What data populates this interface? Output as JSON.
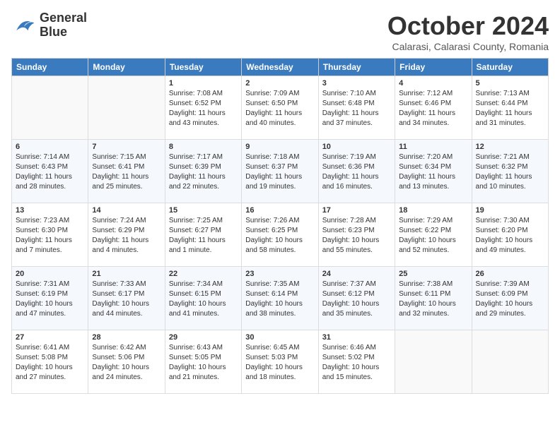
{
  "logo": {
    "line1": "General",
    "line2": "Blue"
  },
  "title": "October 2024",
  "subtitle": "Calarasi, Calarasi County, Romania",
  "headers": [
    "Sunday",
    "Monday",
    "Tuesday",
    "Wednesday",
    "Thursday",
    "Friday",
    "Saturday"
  ],
  "weeks": [
    [
      {
        "day": "",
        "details": ""
      },
      {
        "day": "",
        "details": ""
      },
      {
        "day": "1",
        "details": "Sunrise: 7:08 AM\nSunset: 6:52 PM\nDaylight: 11 hours and 43 minutes."
      },
      {
        "day": "2",
        "details": "Sunrise: 7:09 AM\nSunset: 6:50 PM\nDaylight: 11 hours and 40 minutes."
      },
      {
        "day": "3",
        "details": "Sunrise: 7:10 AM\nSunset: 6:48 PM\nDaylight: 11 hours and 37 minutes."
      },
      {
        "day": "4",
        "details": "Sunrise: 7:12 AM\nSunset: 6:46 PM\nDaylight: 11 hours and 34 minutes."
      },
      {
        "day": "5",
        "details": "Sunrise: 7:13 AM\nSunset: 6:44 PM\nDaylight: 11 hours and 31 minutes."
      }
    ],
    [
      {
        "day": "6",
        "details": "Sunrise: 7:14 AM\nSunset: 6:43 PM\nDaylight: 11 hours and 28 minutes."
      },
      {
        "day": "7",
        "details": "Sunrise: 7:15 AM\nSunset: 6:41 PM\nDaylight: 11 hours and 25 minutes."
      },
      {
        "day": "8",
        "details": "Sunrise: 7:17 AM\nSunset: 6:39 PM\nDaylight: 11 hours and 22 minutes."
      },
      {
        "day": "9",
        "details": "Sunrise: 7:18 AM\nSunset: 6:37 PM\nDaylight: 11 hours and 19 minutes."
      },
      {
        "day": "10",
        "details": "Sunrise: 7:19 AM\nSunset: 6:36 PM\nDaylight: 11 hours and 16 minutes."
      },
      {
        "day": "11",
        "details": "Sunrise: 7:20 AM\nSunset: 6:34 PM\nDaylight: 11 hours and 13 minutes."
      },
      {
        "day": "12",
        "details": "Sunrise: 7:21 AM\nSunset: 6:32 PM\nDaylight: 11 hours and 10 minutes."
      }
    ],
    [
      {
        "day": "13",
        "details": "Sunrise: 7:23 AM\nSunset: 6:30 PM\nDaylight: 11 hours and 7 minutes."
      },
      {
        "day": "14",
        "details": "Sunrise: 7:24 AM\nSunset: 6:29 PM\nDaylight: 11 hours and 4 minutes."
      },
      {
        "day": "15",
        "details": "Sunrise: 7:25 AM\nSunset: 6:27 PM\nDaylight: 11 hours and 1 minute."
      },
      {
        "day": "16",
        "details": "Sunrise: 7:26 AM\nSunset: 6:25 PM\nDaylight: 10 hours and 58 minutes."
      },
      {
        "day": "17",
        "details": "Sunrise: 7:28 AM\nSunset: 6:23 PM\nDaylight: 10 hours and 55 minutes."
      },
      {
        "day": "18",
        "details": "Sunrise: 7:29 AM\nSunset: 6:22 PM\nDaylight: 10 hours and 52 minutes."
      },
      {
        "day": "19",
        "details": "Sunrise: 7:30 AM\nSunset: 6:20 PM\nDaylight: 10 hours and 49 minutes."
      }
    ],
    [
      {
        "day": "20",
        "details": "Sunrise: 7:31 AM\nSunset: 6:19 PM\nDaylight: 10 hours and 47 minutes."
      },
      {
        "day": "21",
        "details": "Sunrise: 7:33 AM\nSunset: 6:17 PM\nDaylight: 10 hours and 44 minutes."
      },
      {
        "day": "22",
        "details": "Sunrise: 7:34 AM\nSunset: 6:15 PM\nDaylight: 10 hours and 41 minutes."
      },
      {
        "day": "23",
        "details": "Sunrise: 7:35 AM\nSunset: 6:14 PM\nDaylight: 10 hours and 38 minutes."
      },
      {
        "day": "24",
        "details": "Sunrise: 7:37 AM\nSunset: 6:12 PM\nDaylight: 10 hours and 35 minutes."
      },
      {
        "day": "25",
        "details": "Sunrise: 7:38 AM\nSunset: 6:11 PM\nDaylight: 10 hours and 32 minutes."
      },
      {
        "day": "26",
        "details": "Sunrise: 7:39 AM\nSunset: 6:09 PM\nDaylight: 10 hours and 29 minutes."
      }
    ],
    [
      {
        "day": "27",
        "details": "Sunrise: 6:41 AM\nSunset: 5:08 PM\nDaylight: 10 hours and 27 minutes."
      },
      {
        "day": "28",
        "details": "Sunrise: 6:42 AM\nSunset: 5:06 PM\nDaylight: 10 hours and 24 minutes."
      },
      {
        "day": "29",
        "details": "Sunrise: 6:43 AM\nSunset: 5:05 PM\nDaylight: 10 hours and 21 minutes."
      },
      {
        "day": "30",
        "details": "Sunrise: 6:45 AM\nSunset: 5:03 PM\nDaylight: 10 hours and 18 minutes."
      },
      {
        "day": "31",
        "details": "Sunrise: 6:46 AM\nSunset: 5:02 PM\nDaylight: 10 hours and 15 minutes."
      },
      {
        "day": "",
        "details": ""
      },
      {
        "day": "",
        "details": ""
      }
    ]
  ]
}
